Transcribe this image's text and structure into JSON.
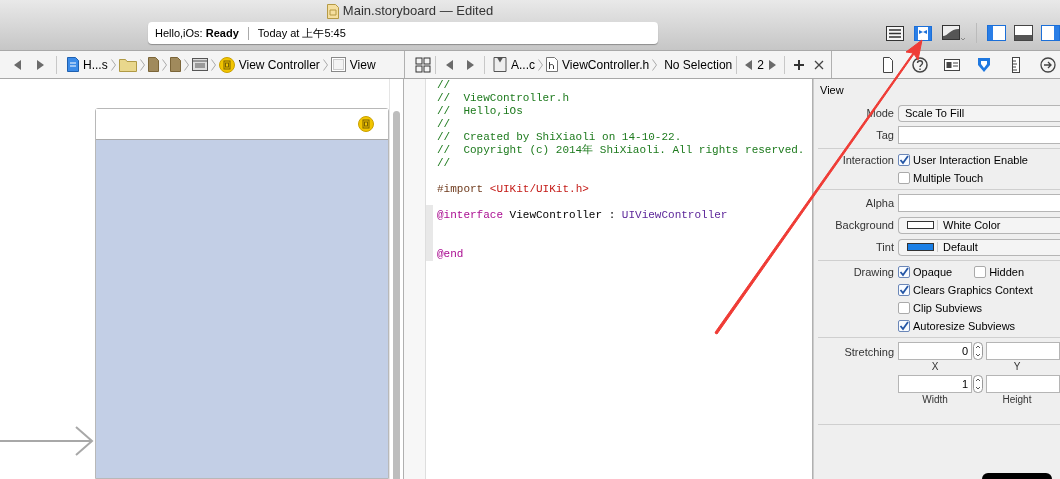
{
  "window": {
    "title": "Main.storyboard — Edited"
  },
  "activity": {
    "project": "Hello,iOs:",
    "status": "Ready",
    "time": "Today at 上午5:45"
  },
  "editor_modes": [
    {
      "kind": "standard",
      "selected": false
    },
    {
      "kind": "assistant",
      "selected": true
    },
    {
      "kind": "version",
      "selected": false
    }
  ],
  "view_toggles": [
    {
      "kind": "navigator",
      "on": true
    },
    {
      "kind": "debug",
      "on": false
    },
    {
      "kind": "utilities",
      "on": true
    }
  ],
  "canvas_jumpbar": {
    "crumbs": [
      {
        "kind": "project",
        "label": "H...s"
      },
      {
        "kind": "folder"
      },
      {
        "kind": "file"
      },
      {
        "kind": "file"
      },
      {
        "kind": "scene"
      },
      {
        "kind": "controller",
        "label": "View Controller"
      },
      {
        "kind": "view",
        "label": "View"
      }
    ]
  },
  "code_jumpbar": {
    "crumbs": [
      {
        "kind": "app",
        "label": "A...c"
      },
      {
        "kind": "header",
        "label": "ViewController.h"
      },
      {
        "kind": "none",
        "label": "No Selection"
      }
    ],
    "counter": "2"
  },
  "code_lines": [
    {
      "kind": "code",
      "segments": [
        {
          "kind": "comment",
          "text": "//"
        }
      ]
    },
    {
      "kind": "code",
      "segments": [
        {
          "kind": "comment",
          "text": "//  ViewController.h"
        }
      ]
    },
    {
      "kind": "code",
      "segments": [
        {
          "kind": "comment",
          "text": "//  Hello,iOs"
        }
      ]
    },
    {
      "kind": "code",
      "segments": [
        {
          "kind": "comment",
          "text": "//"
        }
      ]
    },
    {
      "kind": "code",
      "segments": [
        {
          "kind": "comment",
          "text": "//  Created by ShiXiaoli on 14-10-22."
        }
      ]
    },
    {
      "kind": "code",
      "segments": [
        {
          "kind": "comment",
          "text": "//  Copyright (c) 2014年 ShiXiaoli. All rights reserved."
        }
      ]
    },
    {
      "kind": "code",
      "segments": [
        {
          "kind": "comment",
          "text": "//"
        }
      ]
    },
    {
      "kind": "blank"
    },
    {
      "kind": "code",
      "segments": [
        {
          "kind": "directive",
          "text": "#import "
        },
        {
          "kind": "string",
          "text": "<UIKit/UIKit.h>"
        }
      ]
    },
    {
      "kind": "blank"
    },
    {
      "kind": "code",
      "segments": [
        {
          "kind": "keyword",
          "text": "@interface"
        },
        {
          "kind": "plain",
          "text": " ViewController : "
        },
        {
          "kind": "class",
          "text": "UIViewController"
        }
      ]
    },
    {
      "kind": "blank"
    },
    {
      "kind": "blank"
    },
    {
      "kind": "code",
      "segments": [
        {
          "kind": "keyword",
          "text": "@end"
        }
      ]
    }
  ],
  "inspector": {
    "tabs": [
      {
        "kind": "file",
        "selected": false
      },
      {
        "kind": "help",
        "selected": false
      },
      {
        "kind": "identity",
        "selected": false
      },
      {
        "kind": "attributes",
        "selected": true
      },
      {
        "kind": "size",
        "selected": false
      },
      {
        "kind": "connections",
        "selected": false
      }
    ],
    "section": "View",
    "groups": [
      [
        {
          "kind": "select",
          "label": "Mode",
          "value": "Scale To Fill"
        },
        {
          "kind": "field",
          "label": "Tag"
        }
      ],
      [
        {
          "kind": "checks",
          "label": "Interaction",
          "lines": [
            [
              {
                "label": "User Interaction Enable",
                "checked": true
              }
            ],
            [
              {
                "label": "Multiple Touch",
                "checked": false
              }
            ]
          ]
        }
      ],
      [
        {
          "kind": "field",
          "label": "Alpha"
        },
        {
          "kind": "color",
          "label": "Background",
          "value": "White Color",
          "color": "#ffffff"
        },
        {
          "kind": "color",
          "label": "Tint",
          "value": "Default",
          "color": "#1a7fe6"
        }
      ],
      [
        {
          "kind": "checks",
          "label": "Drawing",
          "lines": [
            [
              {
                "label": "Opaque",
                "checked": true
              },
              {
                "label": "Hidden",
                "checked": false
              }
            ],
            [
              {
                "label": "Clears Graphics Context",
                "checked": true
              }
            ],
            [
              {
                "label": "Clip Subviews",
                "checked": false
              }
            ],
            [
              {
                "label": "Autoresize Subviews",
                "checked": true
              }
            ]
          ]
        }
      ],
      [
        {
          "kind": "stretch",
          "label": "Stretching",
          "pairs": [
            [
              {
                "caption": "X",
                "value": "0"
              },
              {
                "caption": "Y"
              }
            ],
            [
              {
                "caption": "Width",
                "value": "1"
              },
              {
                "caption": "Height"
              }
            ]
          ]
        }
      ]
    ]
  }
}
